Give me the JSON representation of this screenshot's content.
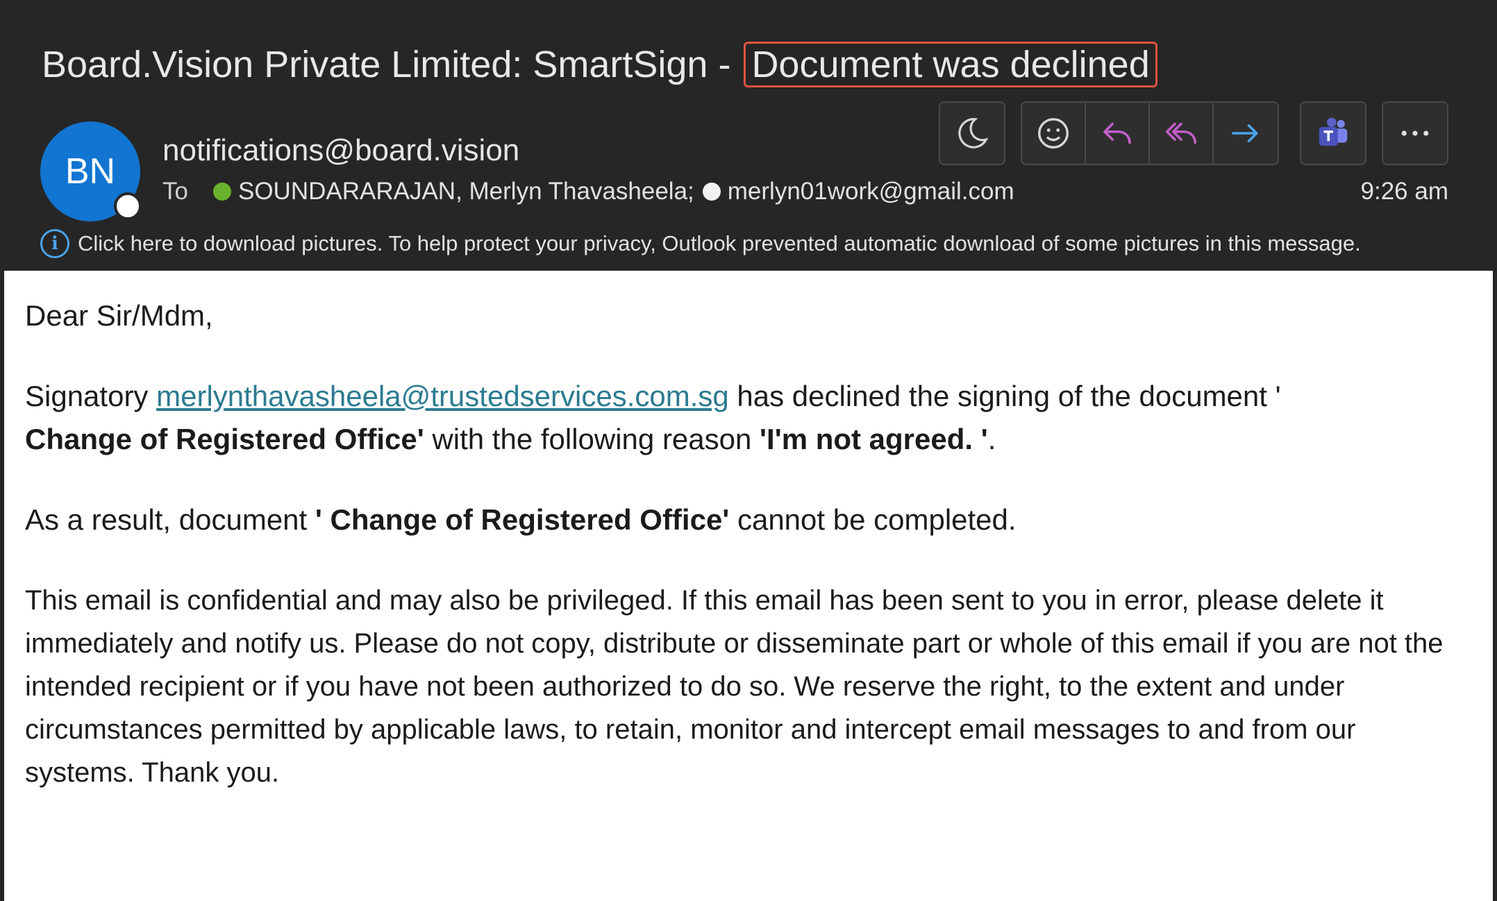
{
  "email": {
    "subject_prefix": "Board.Vision Private Limited: SmartSign - ",
    "subject_highlight": "Document was declined",
    "avatar_initials": "BN",
    "sender": "notifications@board.vision",
    "to_label": "To",
    "recipient_1": "SOUNDARARAJAN, Merlyn Thavasheela;",
    "recipient_2": "merlyn01work@gmail.com",
    "time": "9:26 am",
    "info_icon": "i",
    "info_message": "Click here to download pictures. To help protect your privacy, Outlook prevented automatic download of some pictures in this message."
  },
  "toolbar": {
    "icons": [
      "moon-icon",
      "emoji-icon",
      "reply-icon",
      "reply-all-icon",
      "forward-icon",
      "teams-icon",
      "more-icon"
    ],
    "colors": {
      "reply": "#c25ec8",
      "forward": "#4aa3e8",
      "teams": "#5b5fc7",
      "neutral": "#d8d8d8"
    }
  },
  "body": {
    "greeting": "Dear Sir/Mdm,",
    "p1_a": "Signatory ",
    "p1_link": "merlynthavasheela@trustedservices.com.sg",
    "p1_b": " has declined the signing of the document '",
    "p1_doc": "Change of Registered Office'",
    "p1_c": " with the following reason ",
    "p1_reason": "'I'm not agreed. '",
    "p1_d": ".",
    "p2_a": "As a result, document ",
    "p2_doc": "' Change of Registered Office'",
    "p2_b": " cannot be completed.",
    "disclaimer": "This email is confidential and may also be privileged. If this email has been sent to you in error, please delete it immediately and notify us. Please do not copy, distribute or disseminate part or whole of this email if you are not the intended recipient or if you have not been authorized to do so. We reserve the right, to the extent and under circumstances permitted by applicable laws, to retain, monitor and intercept email messages to and from our systems. Thank you."
  }
}
